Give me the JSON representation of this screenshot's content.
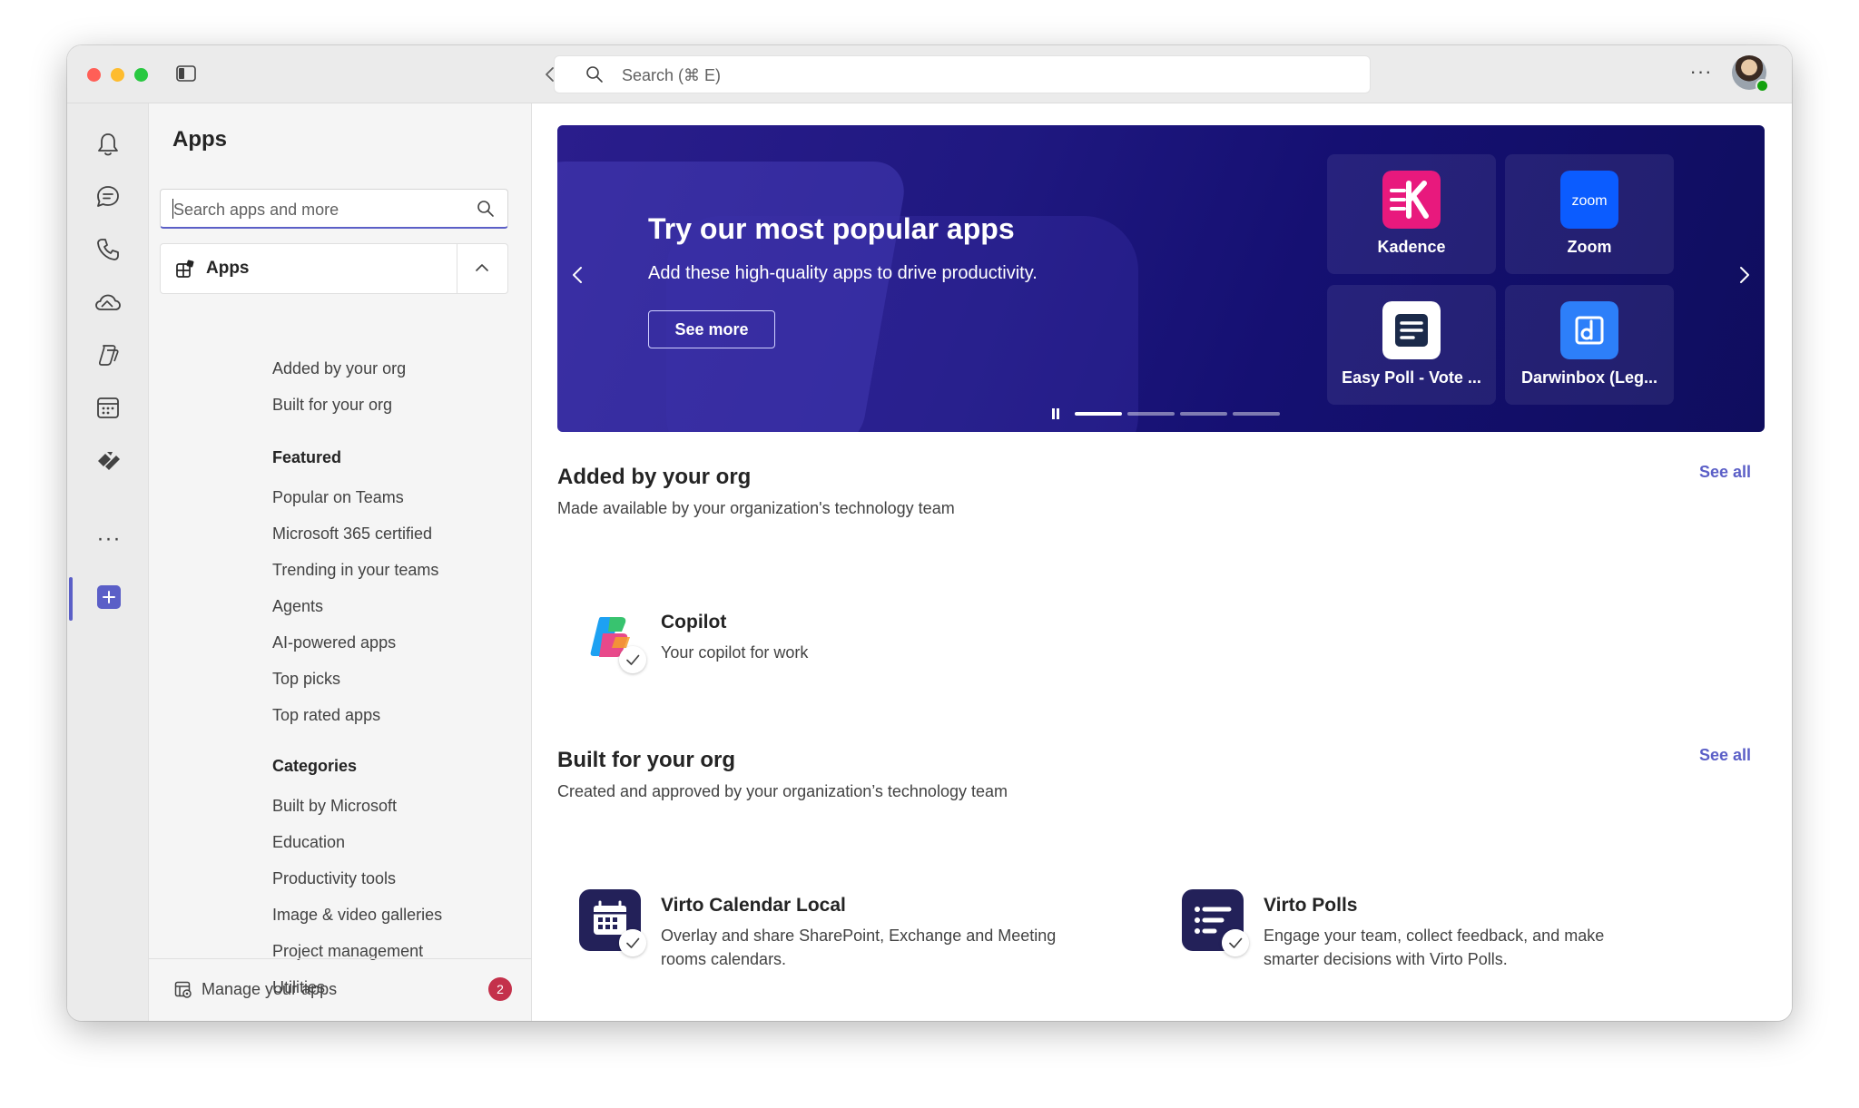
{
  "topbar": {
    "search_placeholder": "Search (⌘ E)",
    "more_label": "···"
  },
  "rail": {
    "icons": [
      "bell-icon",
      "chat-icon",
      "phone-icon",
      "onedrive-icon",
      "copilot-icon",
      "calendar-icon",
      "planner-icon",
      "more-icon",
      "apps-icon"
    ],
    "more_label": "···"
  },
  "leftpane": {
    "title": "Apps",
    "search_placeholder": "Search apps and more",
    "group_label": "Apps",
    "top_links": [
      "Added by your org",
      "Built for your org"
    ],
    "featured_heading": "Featured",
    "featured": [
      "Popular on Teams",
      "Microsoft 365 certified",
      "Trending in your teams",
      "Agents",
      "AI-powered apps",
      "Top picks",
      "Top rated apps"
    ],
    "categories_heading": "Categories",
    "categories": [
      "Built by Microsoft",
      "Education",
      "Productivity tools",
      "Image & video galleries",
      "Project management",
      "Utilities"
    ],
    "manage_label": "Manage your apps",
    "manage_badge": "2"
  },
  "banner": {
    "title": "Try our most popular apps",
    "subtitle": "Add these high-quality apps to drive productivity.",
    "button": "See more",
    "tiles": [
      {
        "name": "Kadence",
        "icon": "kadence-icon",
        "color": "#e8197d"
      },
      {
        "name": "Zoom",
        "icon": "zoom-icon",
        "color": "#0b5cff",
        "logo_text": "zoom"
      },
      {
        "name": "Easy Poll - Vote ...",
        "icon": "easy-poll-icon",
        "color": "#ffffff"
      },
      {
        "name": "Darwinbox (Leg...",
        "icon": "darwinbox-icon",
        "color": "#2d7ff9"
      }
    ],
    "active_dot": 0
  },
  "sections": [
    {
      "title": "Added by your org",
      "subtitle": "Made available by your organization's technology team",
      "see_all": "See all",
      "apps": [
        {
          "name": "Copilot",
          "desc": "Your copilot for work",
          "icon": "copilot-icon"
        }
      ]
    },
    {
      "title": "Built for your org",
      "subtitle": "Created and approved by your organization’s technology team",
      "see_all": "See all",
      "apps": [
        {
          "name": "Virto Calendar Local",
          "desc": "Overlay and share SharePoint, Exchange and Meeting rooms calendars.",
          "icon": "virto-calendar-icon"
        },
        {
          "name": "Virto Polls",
          "desc": "Engage your team, collect feedback, and make smarter decisions with Virto Polls.",
          "icon": "virto-polls-icon"
        }
      ]
    }
  ],
  "colors": {
    "accent": "#5b5fc7",
    "badge": "#c4314b",
    "banner_dark": "#151072"
  }
}
